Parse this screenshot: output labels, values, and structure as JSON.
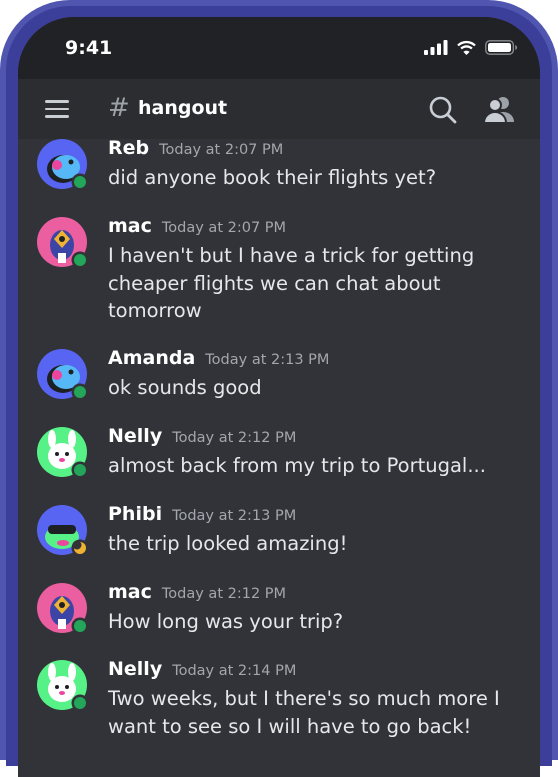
{
  "status_bar": {
    "time": "9:41"
  },
  "header": {
    "hash_symbol": "#",
    "channel_name": "hangout"
  },
  "messages": [
    {
      "username": "Reb",
      "timestamp": "Today at 2:07 PM",
      "text": "did anyone book their flights yet?",
      "status": "online"
    },
    {
      "username": "mac",
      "timestamp": "Today at 2:07 PM",
      "text": "I haven't but I have a trick for getting\ncheaper flights we can chat about\ntomorrow",
      "status": "online"
    },
    {
      "username": "Amanda",
      "timestamp": "Today at 2:13 PM",
      "text": "ok sounds good",
      "status": "online"
    },
    {
      "username": "Nelly",
      "timestamp": "Today at 2:12 PM",
      "text": "almost back from my trip to Portugal...",
      "status": "online"
    },
    {
      "username": "Phibi",
      "timestamp": "Today at 2:13 PM",
      "text": "the trip looked amazing!",
      "status": "idle"
    },
    {
      "username": "mac",
      "timestamp": "Today at 2:12 PM",
      "text": "How long was your trip?",
      "status": "online"
    },
    {
      "username": "Nelly",
      "timestamp": "Today at 2:14 PM",
      "text": "Two weeks, but I there's so much more I\nwant to see so I will have to go back!",
      "status": "online"
    }
  ],
  "colors": {
    "device_frame": "#5056b0",
    "background": "#313338",
    "online": "#23a55a",
    "idle": "#f0b232"
  }
}
